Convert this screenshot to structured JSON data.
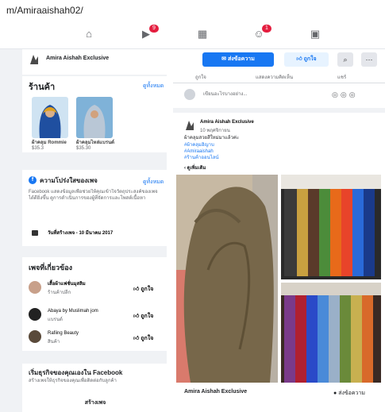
{
  "browser": {
    "url": "m/Amiraaishah02/"
  },
  "topnav": {
    "notif_badge": "9",
    "group_badge": "1"
  },
  "page": {
    "name": "Amira Aishah Exclusive"
  },
  "shop": {
    "title": "ร้านค้า",
    "see_all": "ดูทั้งหมด",
    "products": [
      {
        "name": "ผ้าคลุม Rommie",
        "price": "$35.3"
      },
      {
        "name": "ผ้าคลุมไหล่แบรนด์",
        "price": "$35.30"
      }
    ]
  },
  "transparency": {
    "title": "ความโปร่งใสของเพจ",
    "see_all": "ดูทั้งหมด",
    "description": "Facebook แสดงข้อมูลเพื่อช่วยให้คุณเข้าใจวัตถุประสงค์ของเพจได้ดียิ่งขึ้น ดูการดำเนินการของผู้ที่จัดการและโพสต์เนื้อหา",
    "created": "วันที่สร้างเพจ - 10 มีนาคม 2017"
  },
  "related": {
    "title": "เพจที่เกี่ยวข้อง",
    "items": [
      {
        "name": "เสื้อผ้าแฟชั่นมุสลิม",
        "category": "ร้านค้าปลีก",
        "like": "ถูกใจ"
      },
      {
        "name": "Abaya by Muslimah jom",
        "category": "แบรนด์",
        "like": "ถูกใจ"
      },
      {
        "name": "Rafiing Beauty",
        "category": "สินค้า",
        "like": "ถูกใจ"
      }
    ]
  },
  "create": {
    "title": "เริ่มธุรกิจของคุณเองใน Facebook",
    "desc": "สร้างเพจให้ธุรกิจของคุณเพื่อติดต่อกับลูกค้า",
    "button": "สร้างเพจ"
  },
  "actions": {
    "send_message": "ส่งข้อความ",
    "like": "ถูกใจ",
    "search_icon": "search-icon",
    "more_icon": "more-icon"
  },
  "tabs": [
    "ถูกใจ",
    "แสดงความคิดเห็น",
    "แชร์"
  ],
  "composer": {
    "placeholder": "เขียนอะไรบางอย่าง..."
  },
  "post": {
    "author": "Amira Aishah Exclusive",
    "time": "10 พฤศจิกายน",
    "text": "ผ้าคลุมสวยสีใหม่มาแล้วค่ะ",
    "hashtags": [
      "#ผ้าคลุมฮิญาบ",
      "#Amiraaishah",
      "#ร้านค้าออนไลน์"
    ],
    "see_more": "ดูเพิ่มเติม",
    "footer_name": "Amira Aishah Exclusive",
    "footer_button": "ส่งข้อความ"
  },
  "colors": {
    "brand": "#1877f2",
    "badge": "#e41e3f",
    "left_bg": "#f0f2f5"
  }
}
